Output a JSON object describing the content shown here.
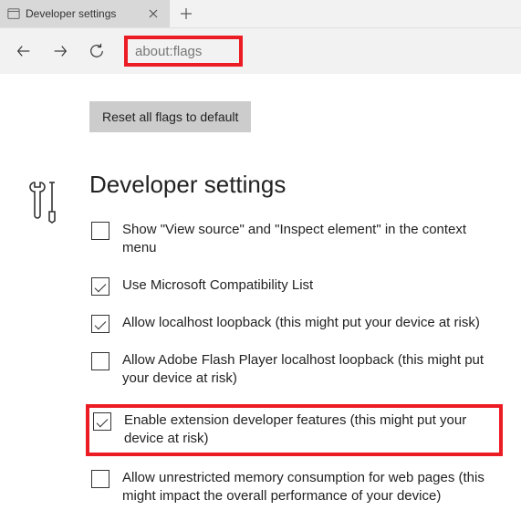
{
  "tab": {
    "title": "Developer settings"
  },
  "address": {
    "text": "about:flags"
  },
  "reset": {
    "label": "Reset all flags to default"
  },
  "section": {
    "title": "Developer settings"
  },
  "options": [
    {
      "label": "Show \"View source\" and \"Inspect element\" in the context menu",
      "checked": false,
      "highlighted": false
    },
    {
      "label": "Use Microsoft Compatibility List",
      "checked": true,
      "highlighted": false
    },
    {
      "label": "Allow localhost loopback (this might put your device at risk)",
      "checked": true,
      "highlighted": false
    },
    {
      "label": "Allow Adobe Flash Player localhost loopback (this might put your device at risk)",
      "checked": false,
      "highlighted": false
    },
    {
      "label": "Enable extension developer features (this might put your device at risk)",
      "checked": true,
      "highlighted": true
    },
    {
      "label": "Allow unrestricted memory consumption for web pages (this might impact the overall performance of your device)",
      "checked": false,
      "highlighted": false
    }
  ]
}
